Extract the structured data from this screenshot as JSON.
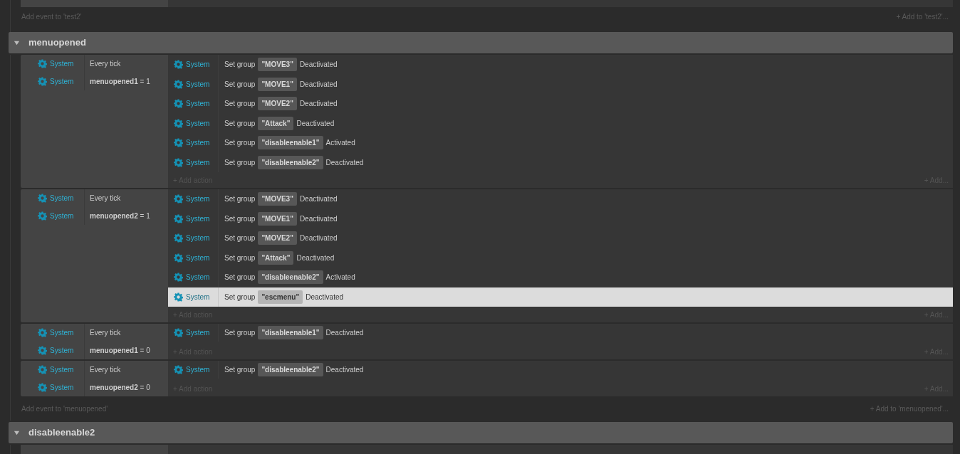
{
  "previous_group": {
    "add_event": "Add event to 'test2'",
    "add_to": "+ Add to 'test2'..."
  },
  "groups": [
    {
      "title": "menuopened",
      "expanded": true,
      "events": [
        {
          "conditions": [
            {
              "object": "System",
              "text": "Every tick"
            },
            {
              "object": "System",
              "text": "**menuopened1** = 1"
            }
          ],
          "actions": [
            {
              "object": "System",
              "verb": "Set group",
              "param": "\"MOVE3\"",
              "value": "Deactivated",
              "selected": false
            },
            {
              "object": "System",
              "verb": "Set group",
              "param": "\"MOVE1\"",
              "value": "Deactivated",
              "selected": false
            },
            {
              "object": "System",
              "verb": "Set group",
              "param": "\"MOVE2\"",
              "value": "Deactivated",
              "selected": false
            },
            {
              "object": "System",
              "verb": "Set group",
              "param": "\"Attack\"",
              "value": "Deactivated",
              "selected": false
            },
            {
              "object": "System",
              "verb": "Set group",
              "param": "\"disableenable1\"",
              "value": "Activated",
              "selected": false
            },
            {
              "object": "System",
              "verb": "Set group",
              "param": "\"disableenable2\"",
              "value": "Deactivated",
              "selected": false
            }
          ],
          "add_action": "+ Add action",
          "add_more": "+ Add..."
        },
        {
          "conditions": [
            {
              "object": "System",
              "text": "Every tick"
            },
            {
              "object": "System",
              "text": "**menuopened2** = 1"
            }
          ],
          "actions": [
            {
              "object": "System",
              "verb": "Set group",
              "param": "\"MOVE3\"",
              "value": "Deactivated",
              "selected": false
            },
            {
              "object": "System",
              "verb": "Set group",
              "param": "\"MOVE1\"",
              "value": "Deactivated",
              "selected": false
            },
            {
              "object": "System",
              "verb": "Set group",
              "param": "\"MOVE2\"",
              "value": "Deactivated",
              "selected": false
            },
            {
              "object": "System",
              "verb": "Set group",
              "param": "\"Attack\"",
              "value": "Deactivated",
              "selected": false
            },
            {
              "object": "System",
              "verb": "Set group",
              "param": "\"disableenable2\"",
              "value": "Activated",
              "selected": false
            },
            {
              "object": "System",
              "verb": "Set group",
              "param": "\"escmenu\"",
              "value": "Deactivated",
              "selected": true
            }
          ],
          "add_action": "+ Add action",
          "add_more": "+ Add..."
        },
        {
          "conditions": [
            {
              "object": "System",
              "text": "Every tick"
            },
            {
              "object": "System",
              "text": "**menuopened1** = 0"
            }
          ],
          "actions": [
            {
              "object": "System",
              "verb": "Set group",
              "param": "\"disableenable1\"",
              "value": "Deactivated",
              "selected": false
            }
          ],
          "add_action": "+ Add action",
          "add_more": "+ Add..."
        },
        {
          "conditions": [
            {
              "object": "System",
              "text": "Every tick"
            },
            {
              "object": "System",
              "text": "**menuopened2** = 0"
            }
          ],
          "actions": [
            {
              "object": "System",
              "verb": "Set group",
              "param": "\"disableenable2\"",
              "value": "Deactivated",
              "selected": false
            }
          ],
          "add_action": "+ Add action",
          "add_more": "+ Add..."
        }
      ],
      "add_event": "Add event to 'menuopened'",
      "add_to": "+ Add to 'menuopened'..."
    },
    {
      "title": "disableenable2",
      "expanded": true
    }
  ]
}
